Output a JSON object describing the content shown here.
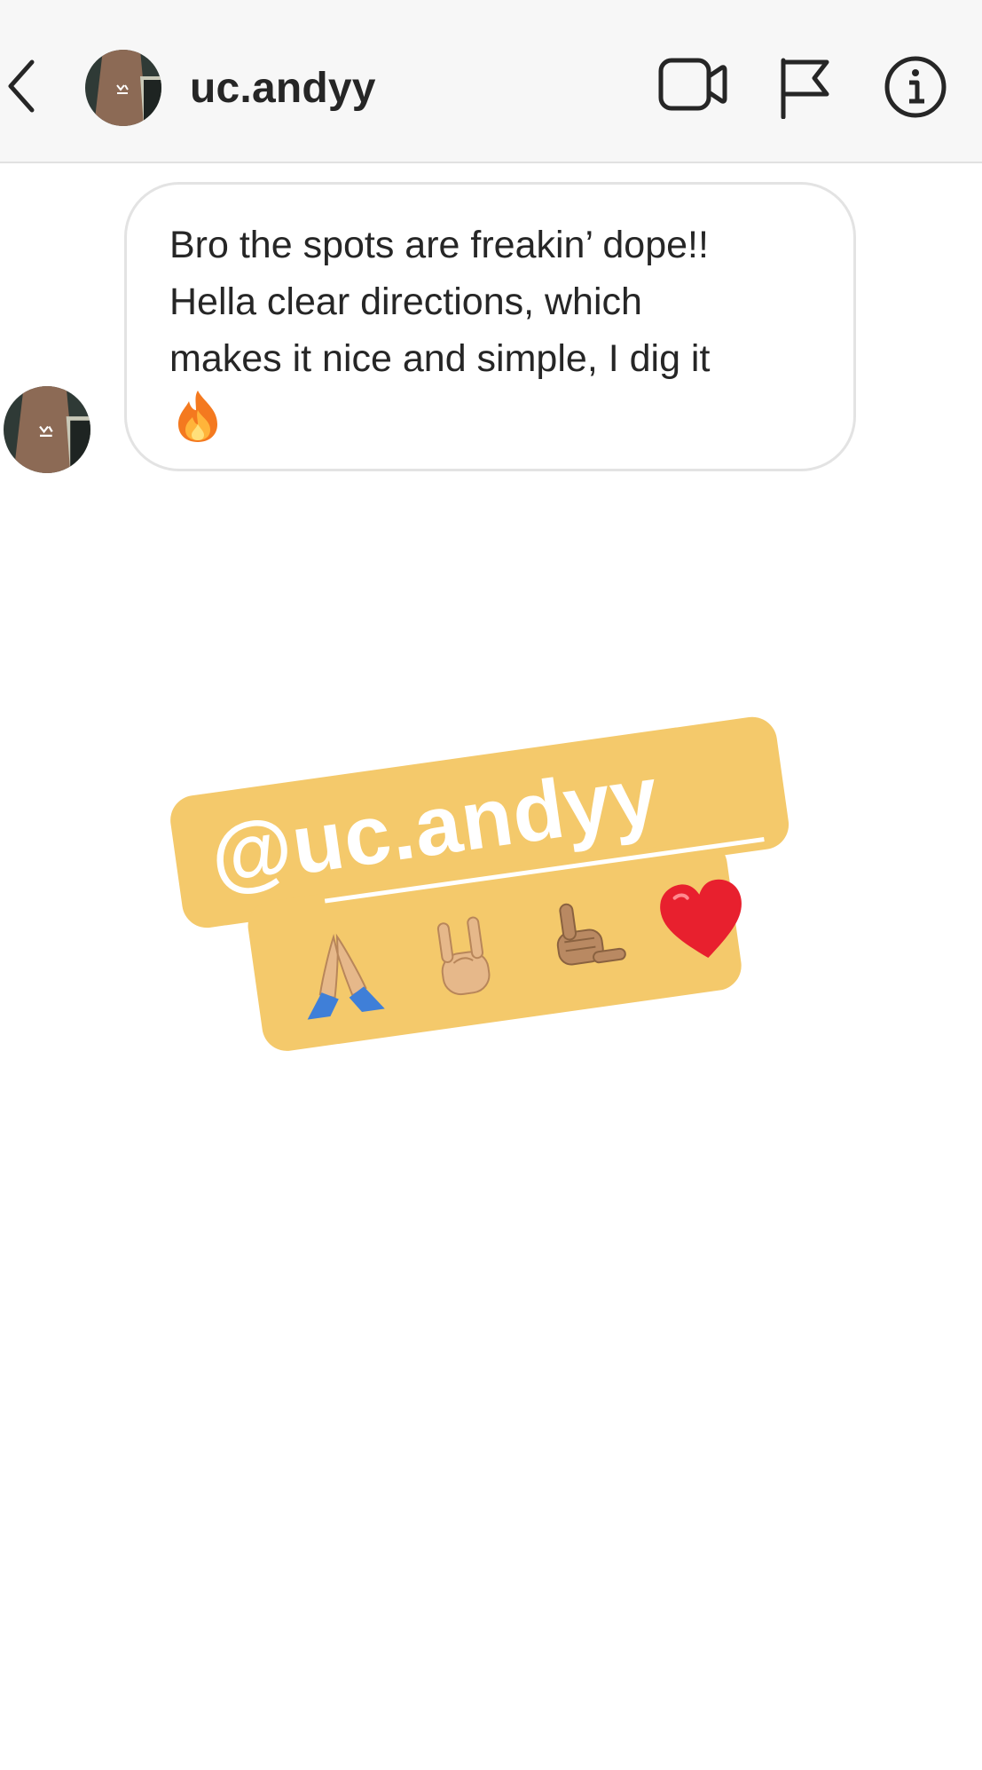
{
  "header": {
    "username": "uc.andyy",
    "icons": [
      "back-icon",
      "video-call-icon",
      "flag-icon",
      "info-icon"
    ]
  },
  "message": {
    "text": "Bro the spots are freakin’ dope!!\nHella clear directions, which\nmakes it nice and simple, I dig it",
    "emoji": "fire-emoji"
  },
  "sticker": {
    "mention": "@uc.andyy",
    "emojis": [
      "folded-hands-emoji",
      "rock-on-emoji",
      "call-me-hand-emoji",
      "red-heart-emoji"
    ],
    "background_color": "#f4c96b"
  },
  "colors": {
    "header_bg": "#f7f7f7",
    "bubble_border": "#e3e3e3",
    "text": "#262626"
  }
}
